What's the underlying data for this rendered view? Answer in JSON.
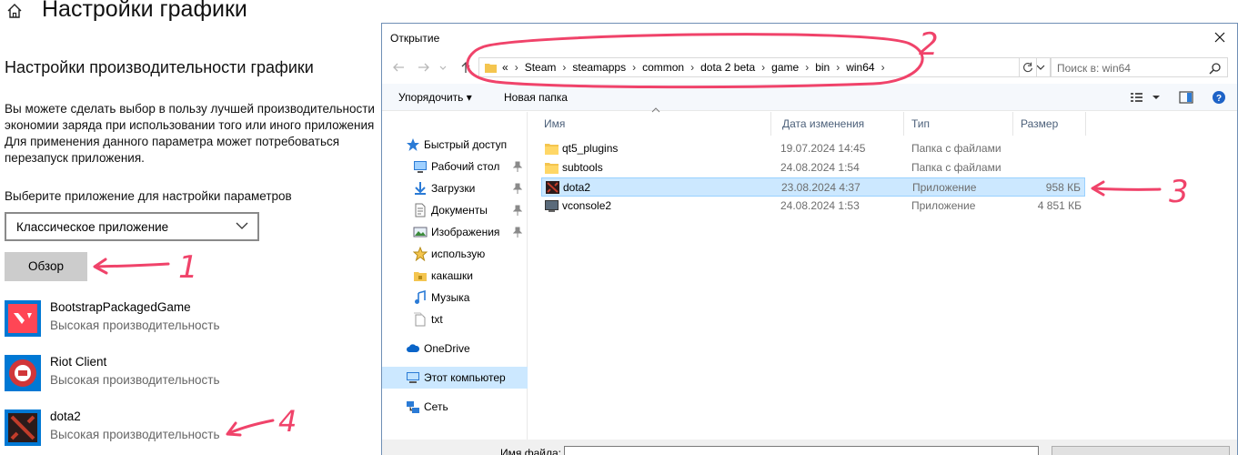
{
  "settings": {
    "title": "Настройки графики",
    "section_title": "Настройки производительности графики",
    "description_lines": [
      "Вы можете сделать выбор в пользу лучшей производительности",
      "экономии заряда при использовании того или иного приложения",
      "Для применения данного параметра может потребоваться",
      "перезапуск приложения."
    ],
    "choose_label": "Выберите приложение для настройки параметров",
    "app_type_value": "Классическое приложение",
    "browse_label": "Обзор",
    "apps": [
      {
        "name": "BootstrapPackagedGame",
        "preference": "Высокая производительность",
        "icon": "valorant-icon",
        "color": "#ff4655"
      },
      {
        "name": "Riot Client",
        "preference": "Высокая производительность",
        "icon": "riot-client-icon",
        "color": "#d13639"
      },
      {
        "name": "dota2",
        "preference": "Высокая производительность",
        "icon": "dota2-icon",
        "color": "#0078d4"
      }
    ]
  },
  "dialog": {
    "title": "Открытие",
    "breadcrumb": [
      "«",
      "Steam",
      "steamapps",
      "common",
      "dota 2 beta",
      "game",
      "bin",
      "win64"
    ],
    "search_placeholder": "Поиск в: win64",
    "toolbar": {
      "organize_label": "Упорядочить ▾",
      "new_folder_label": "Новая папка"
    },
    "nav_items": [
      {
        "label": "Быстрый доступ",
        "icon": "star-icon",
        "pinned": false
      },
      {
        "label": "Рабочий стол",
        "icon": "desktop-icon",
        "pinned": true
      },
      {
        "label": "Загрузки",
        "icon": "download-icon",
        "pinned": true
      },
      {
        "label": "Документы",
        "icon": "document-icon",
        "pinned": true
      },
      {
        "label": "Изображения",
        "icon": "pictures-icon",
        "pinned": true
      },
      {
        "label": "использую",
        "icon": "star-folder-icon",
        "pinned": false
      },
      {
        "label": "какашки",
        "icon": "lock-folder-icon",
        "pinned": false
      },
      {
        "label": "Музыка",
        "icon": "music-icon",
        "pinned": false
      },
      {
        "label": "txt",
        "icon": "txt-folder-icon",
        "pinned": false
      },
      {
        "label": "OneDrive",
        "icon": "cloud-icon",
        "pinned": false
      },
      {
        "label": "Этот компьютер",
        "icon": "computer-icon",
        "pinned": false
      },
      {
        "label": "Сеть",
        "icon": "network-icon",
        "pinned": false
      }
    ],
    "columns": {
      "name": "Имя",
      "date": "Дата изменения",
      "type": "Тип",
      "size": "Размер"
    },
    "files": [
      {
        "name": "qt5_plugins",
        "date": "19.07.2024 14:45",
        "type": "Папка с файлами",
        "size": "",
        "icon": "folder-icon"
      },
      {
        "name": "subtools",
        "date": "24.08.2024 1:54",
        "type": "Папка с файлами",
        "size": "",
        "icon": "folder-icon"
      },
      {
        "name": "dota2",
        "date": "23.08.2024 4:37",
        "type": "Приложение",
        "size": "958 КБ",
        "icon": "dota2-exe-icon",
        "selected": true
      },
      {
        "name": "vconsole2",
        "date": "24.08.2024 1:53",
        "type": "Приложение",
        "size": "4 851 КБ",
        "icon": "vconsole-exe-icon"
      }
    ],
    "filename_label": "Имя файла:"
  },
  "annotations": [
    "1",
    "2",
    "3",
    "4"
  ],
  "colors": {
    "annotation": "#f0436a",
    "selection": "#cce8ff",
    "accent": "#0078d4"
  }
}
